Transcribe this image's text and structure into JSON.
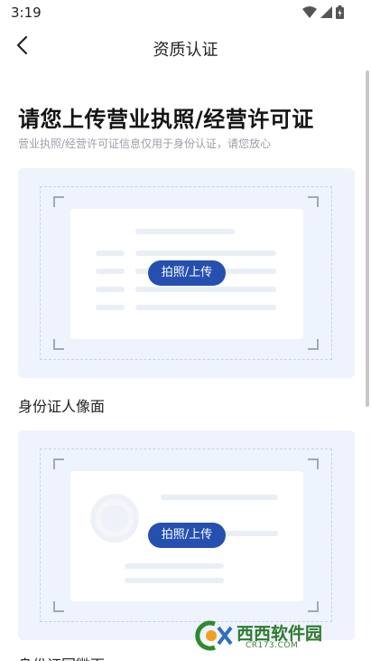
{
  "status_bar": {
    "time": "3:19"
  },
  "nav": {
    "title": "资质认证"
  },
  "heading": "请您上传营业执照/经营许可证",
  "subheading": "营业执照/经营许可证信息仅用于身份认证，请您放心",
  "cards": [
    {
      "button_label": "拍照/上传"
    },
    {
      "button_label": "拍照/上传"
    }
  ],
  "sections": [
    {
      "label": "身份证人像面"
    },
    {
      "label": "身份证国徽面"
    }
  ],
  "watermark": {
    "text": "西西软件园",
    "url": "CR173.COM"
  },
  "colors": {
    "accent": "#2650b0",
    "card_bg": "#eef3fd",
    "hint": "#9aa0a8"
  }
}
